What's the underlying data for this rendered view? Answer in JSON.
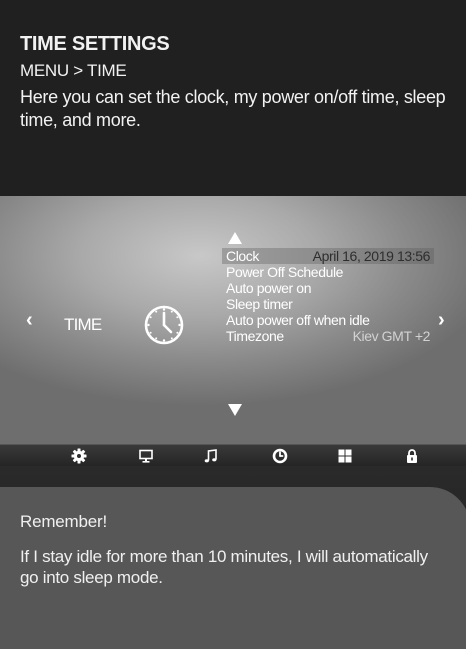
{
  "info": {
    "title": "TIME SETTINGS",
    "breadcrumb": "MENU > TIME",
    "description": "Here you can set the clock, my power on/off time, sleep time, and more."
  },
  "tv_menu": {
    "category": "TIME",
    "left_arrow": "‹",
    "right_arrow": "›",
    "category_icon": "clock-icon",
    "items": [
      {
        "label": "Clock",
        "value": "April 16, 2019 13:56",
        "selected": true
      },
      {
        "label": "Power Off Schedule",
        "value": ""
      },
      {
        "label": "Auto power on",
        "value": ""
      },
      {
        "label": "Sleep timer",
        "value": ""
      },
      {
        "label": "Auto power off when idle",
        "value": ""
      },
      {
        "label": "Timezone",
        "value": "Kiev GMT +2"
      }
    ]
  },
  "category_bar": {
    "icons": [
      "gear-icon",
      "monitor-icon",
      "music-note-icon",
      "clock-icon",
      "grid-icon",
      "lock-icon"
    ],
    "active": "clock-icon"
  },
  "remember": {
    "title": "Remember!",
    "text": "If I stay idle for more than 10 minutes, I will automatically go into sleep mode."
  },
  "colors": {
    "header_bg": "#202020",
    "card_bg": "#575757",
    "text": "#f2f2f2"
  }
}
